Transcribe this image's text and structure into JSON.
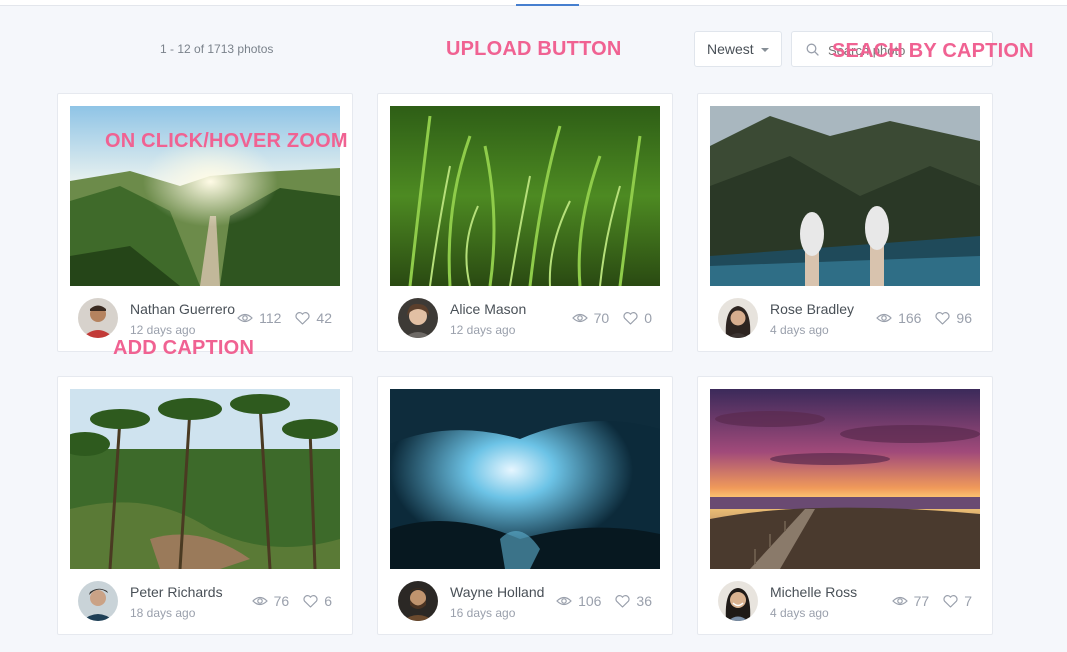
{
  "toolbar": {
    "count_text": "1 - 12 of 1713 photos",
    "sort_label": "Newest",
    "search_placeholder": "Search photo"
  },
  "annotations": {
    "upload": "UPLOAD BUTTON",
    "search": "SEACH BY CAPTION",
    "zoom": "ON CLICK/HOVER ZOOM",
    "caption": "ADD CAPTION"
  },
  "cards": [
    {
      "name": "Nathan Guerrero",
      "time": "12 days ago",
      "views": "112",
      "likes": "42"
    },
    {
      "name": "Alice Mason",
      "time": "12 days ago",
      "views": "70",
      "likes": "0"
    },
    {
      "name": "Rose Bradley",
      "time": "4 days ago",
      "views": "166",
      "likes": "96"
    },
    {
      "name": "Peter Richards",
      "time": "18 days ago",
      "views": "76",
      "likes": "6"
    },
    {
      "name": "Wayne Holland",
      "time": "16 days ago",
      "views": "106",
      "likes": "36"
    },
    {
      "name": "Michelle Ross",
      "time": "4 days ago",
      "views": "77",
      "likes": "7"
    }
  ],
  "icons": {
    "views": "eye-icon",
    "likes": "heart-icon",
    "search": "search-icon",
    "sort": "caret-down-icon"
  },
  "colors": {
    "annotation": "#f06292",
    "accent": "#467fcf"
  }
}
